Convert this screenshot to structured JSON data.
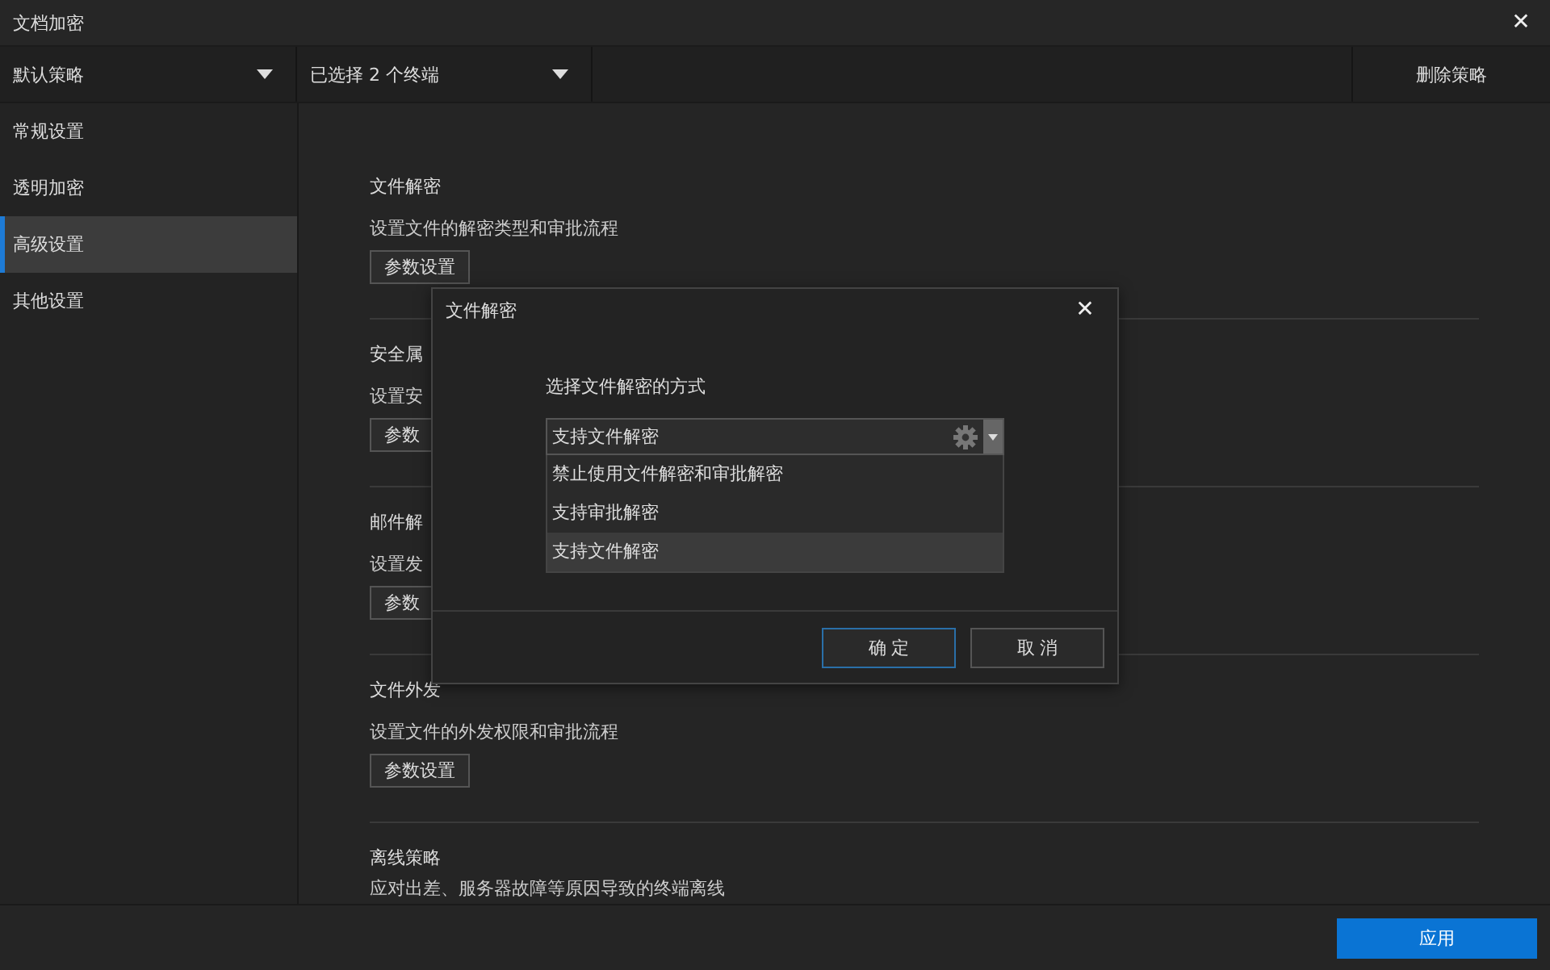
{
  "window": {
    "title": "文档加密",
    "close": "✕"
  },
  "toolbar": {
    "policy": "默认策略",
    "terminals": "已选择 2 个终端",
    "delete": "删除策略"
  },
  "sidebar": {
    "items": [
      {
        "label": "常规设置",
        "selected": false
      },
      {
        "label": "透明加密",
        "selected": false
      },
      {
        "label": "高级设置",
        "selected": true
      },
      {
        "label": "其他设置",
        "selected": false
      }
    ]
  },
  "sections": [
    {
      "title": "文件解密",
      "description": "设置文件的解密类型和审批流程",
      "button": "参数设置"
    },
    {
      "title": "安全属",
      "description": "设置安",
      "button": "参数"
    },
    {
      "title": "邮件解",
      "description": "设置发",
      "button": "参数"
    },
    {
      "title": "文件外发",
      "description": "设置文件的外发权限和审批流程",
      "button": "参数设置"
    },
    {
      "title": "离线策略",
      "description": "应对出差、服务器故障等原因导致的终端离线"
    }
  ],
  "dialog": {
    "title": "文件解密",
    "close": "✕",
    "prompt": "选择文件解密的方式",
    "value": "支持文件解密",
    "options": [
      {
        "label": "禁止使用文件解密和审批解密",
        "selected": false
      },
      {
        "label": "支持审批解密",
        "selected": false
      },
      {
        "label": "支持文件解密",
        "selected": true
      }
    ],
    "buttons": [
      {
        "label": "确 定",
        "kind": "primary"
      },
      {
        "label": "取 消",
        "kind": "secondary"
      }
    ]
  },
  "footer": {
    "apply": "应用"
  }
}
